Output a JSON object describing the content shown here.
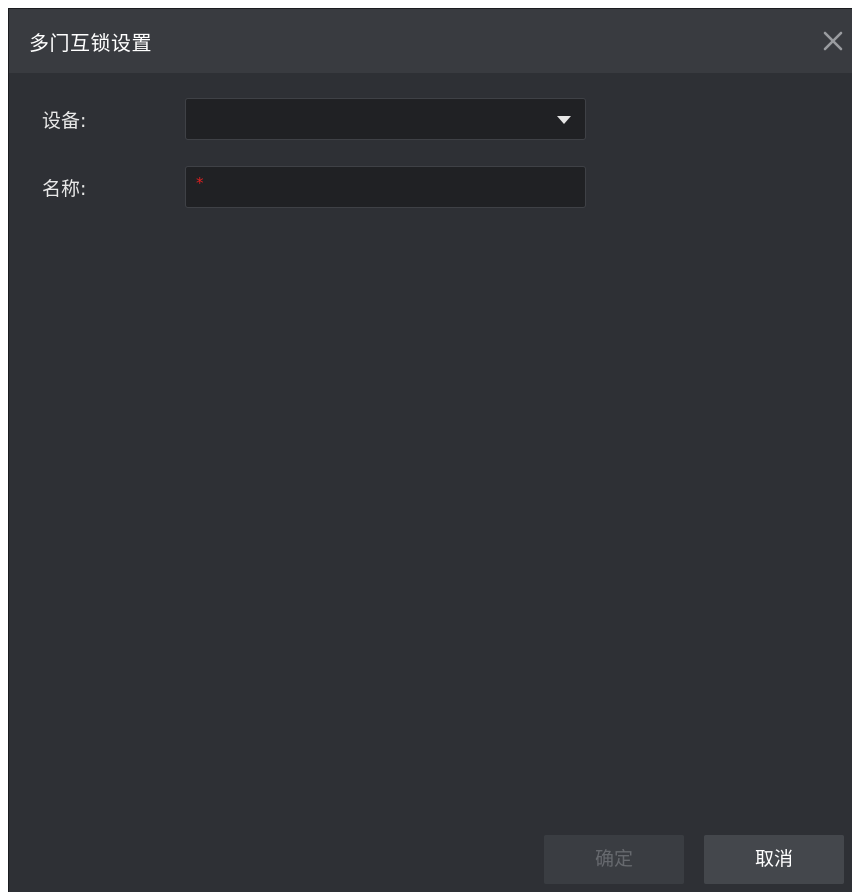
{
  "dialog": {
    "title": "多门互锁设置",
    "close_icon": "close-icon"
  },
  "form": {
    "device_label": "设备:",
    "device_value": "",
    "device_dropdown_icon": "chevron-down-icon",
    "name_label": "名称:",
    "name_required_mark": "*",
    "name_value": ""
  },
  "buttons": {
    "ok_label": "确定",
    "ok_disabled": true,
    "cancel_label": "取消"
  },
  "colors": {
    "background": "#2e3035",
    "titlebar": "#393b40",
    "input_background": "#202124",
    "required": "#e02020"
  }
}
